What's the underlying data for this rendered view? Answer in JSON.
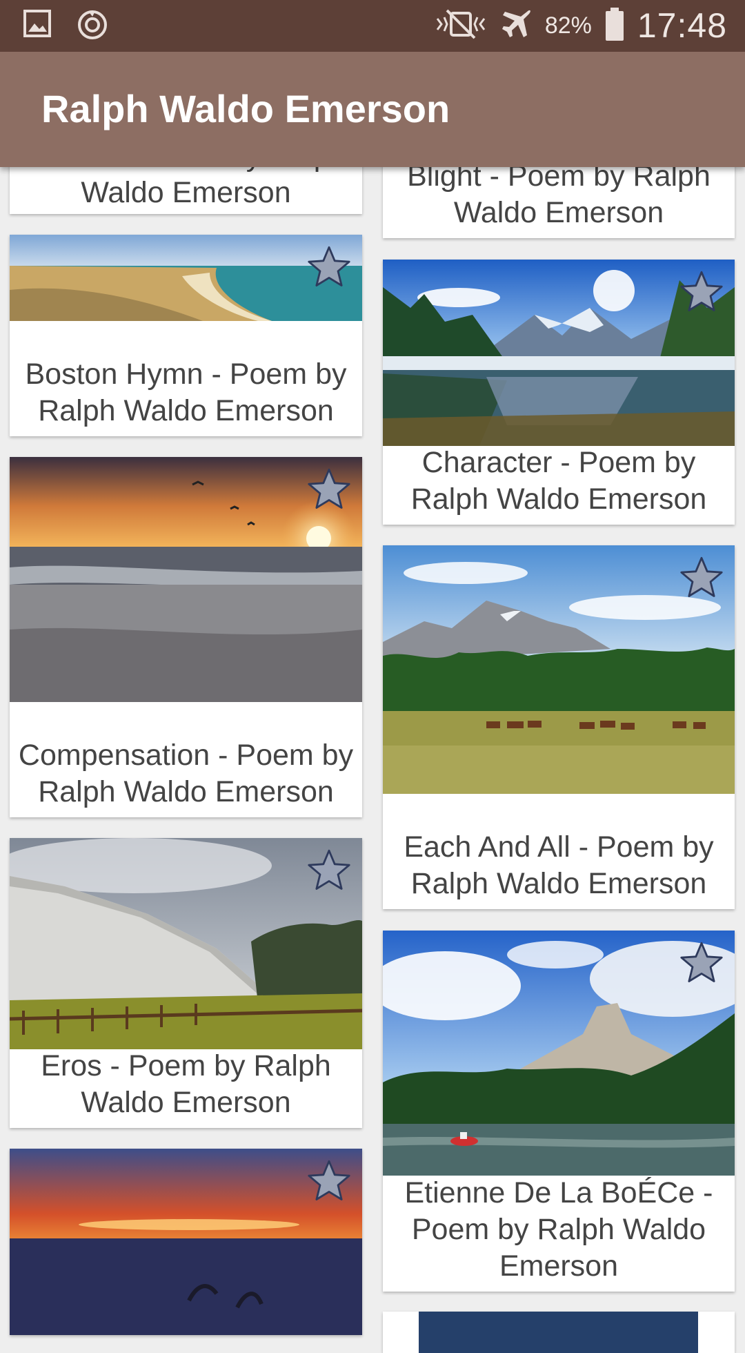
{
  "status_bar": {
    "icons": [
      "gallery-icon",
      "sync-icon",
      "vibrate-icon",
      "airplane-icon",
      "battery-icon"
    ],
    "battery": "82%",
    "time": "17:48"
  },
  "app_bar": {
    "title": "Ralph Waldo Emerson"
  },
  "colors": {
    "status_bar": "#5d4037",
    "app_bar": "#8d6e63",
    "background": "#eeeeee",
    "star_fill": "#9aa3b6",
    "star_stroke": "#2e3a5c"
  },
  "cards": [
    {
      "title": "Boston - Poem by Ralph Waldo Emerson"
    },
    {
      "title": "Blight - Poem by Ralph Waldo Emerson"
    },
    {
      "title": "Boston Hymn - Poem by Ralph Waldo Emerson"
    },
    {
      "title": "Character - Poem by Ralph Waldo Emerson"
    },
    {
      "title": "Compensation - Poem by Ralph Waldo Emerson"
    },
    {
      "title": "Each And All - Poem by Ralph Waldo Emerson"
    },
    {
      "title": "Eros - Poem by Ralph Waldo Emerson"
    },
    {
      "title": "Etienne De La BoÉCe - Poem by Ralph Waldo Emerson"
    },
    {
      "title": ""
    },
    {
      "title": ""
    }
  ]
}
